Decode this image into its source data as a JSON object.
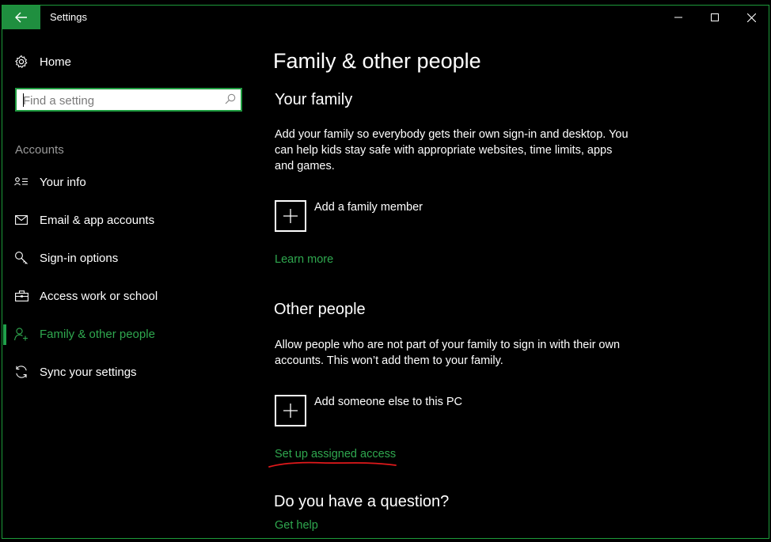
{
  "window": {
    "title": "Settings"
  },
  "colors": {
    "accent": "#1fa14a",
    "link": "#2fa84f",
    "annotation": "#e0191b"
  },
  "sidebar": {
    "home_label": "Home",
    "search_placeholder": "Find a setting",
    "section": "Accounts",
    "items": [
      {
        "label": "Your info",
        "icon": "person-card-icon"
      },
      {
        "label": "Email & app accounts",
        "icon": "mail-icon"
      },
      {
        "label": "Sign-in options",
        "icon": "key-icon"
      },
      {
        "label": "Access work or school",
        "icon": "briefcase-icon"
      },
      {
        "label": "Family & other people",
        "icon": "person-add-icon",
        "selected": true
      },
      {
        "label": "Sync your settings",
        "icon": "sync-icon"
      }
    ]
  },
  "main": {
    "title": "Family & other people",
    "family": {
      "heading": "Your family",
      "description": "Add your family so everybody gets their own sign-in and desktop. You can help kids stay safe with appropriate websites, time limits, apps and games.",
      "add_label": "Add a family member",
      "learn_more": "Learn more"
    },
    "other": {
      "heading": "Other people",
      "description": "Allow people who are not part of your family to sign in with their own accounts. This won’t add them to your family.",
      "add_label": "Add someone else to this PC",
      "assigned_access": "Set up assigned access"
    },
    "question": {
      "heading": "Do you have a question?",
      "help": "Get help"
    }
  }
}
